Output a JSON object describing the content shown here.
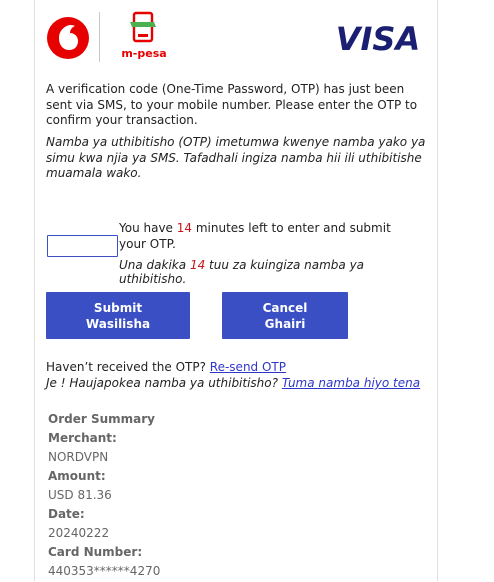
{
  "brand": {
    "vodafone_logo": "vodafone-logo",
    "mpesa_logo_text": "m-pesa",
    "visa_logo_text": "VISA",
    "colors": {
      "vodafone_red": "#e60000",
      "mpesa_green": "#4caf50",
      "visa_blue": "#1a1f71",
      "button_blue": "#3b4fc4",
      "highlight_red": "#c4161c",
      "link_blue": "#2f37c8"
    }
  },
  "intro": {
    "en": "A verification code (One-Time Password, OTP) has just been sent via SMS, to your mobile number. Please enter the OTP to confirm your transaction.",
    "sw": "Namba ya uthibitisho (OTP) imetumwa kwenye namba yako ya simu kwa njia ya SMS. Tafadhali ingiza namba hii ili uthibitishe muamala wako."
  },
  "otp": {
    "input_value": "",
    "timer_en_prefix": "You have ",
    "minutes": "14",
    "timer_en_suffix": " minutes left to enter and submit your OTP.",
    "timer_sw_prefix": "Una dakika ",
    "timer_sw_suffix": " tuu za kuingiza namba ya uthibitisho."
  },
  "buttons": {
    "submit_en": "Submit",
    "submit_sw": "Wasilisha",
    "cancel_en": "Cancel",
    "cancel_sw": "Ghairi"
  },
  "resend": {
    "en_text": "Haven’t received the OTP? ",
    "en_link": "Re-send OTP",
    "sw_text": "Je ! Haujapokea namba ya uthibitisho? ",
    "sw_link": "Tuma namba hiyo tena"
  },
  "summary": {
    "title": "Order Summary",
    "merchant_label": "Merchant:",
    "merchant": "NORDVPN",
    "amount_label": "Amount:",
    "amount": "USD 81.36",
    "date_label": "Date:",
    "date": "20240222",
    "card_label": "Card Number:",
    "card": "440353******4270"
  }
}
